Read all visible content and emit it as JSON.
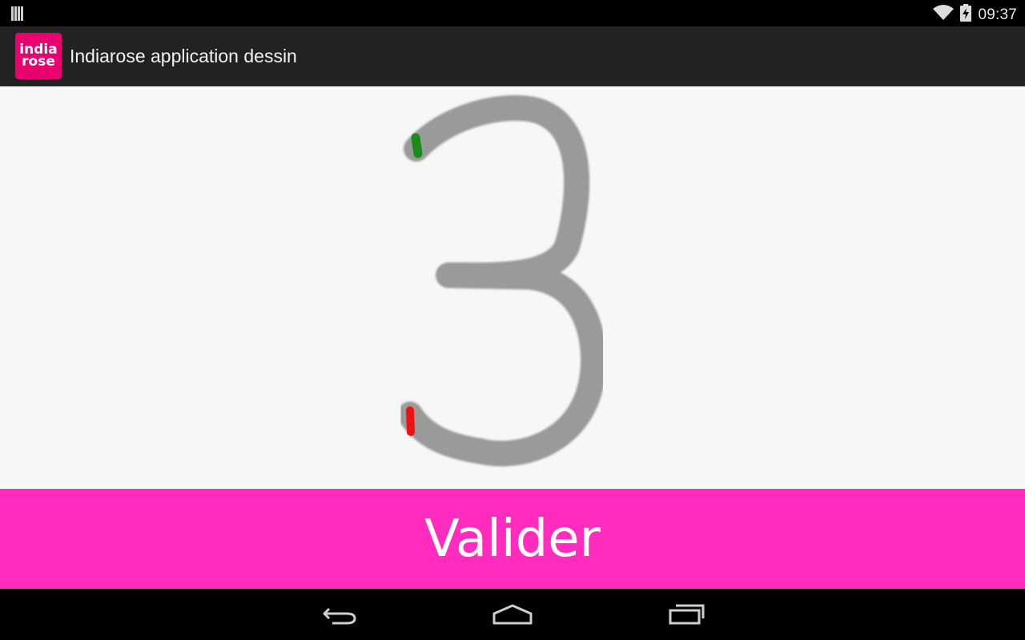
{
  "status_bar": {
    "time": "09:37",
    "icons": [
      "notification-bars-icon",
      "wifi-icon",
      "battery-charging-icon"
    ]
  },
  "action_bar": {
    "logo": {
      "line1": "india",
      "line2": "rose"
    },
    "title": "Indiarose application dessin"
  },
  "canvas": {
    "traced_character": "3",
    "start_marker_color": "#1a8a1a",
    "end_marker_color": "#ee1111",
    "stroke_color": "#9a9a9a"
  },
  "validate_button": {
    "label": "Valider",
    "color": "#ff2cbd"
  },
  "navigation": {
    "buttons": [
      "back-icon",
      "home-icon",
      "recent-apps-icon"
    ]
  }
}
